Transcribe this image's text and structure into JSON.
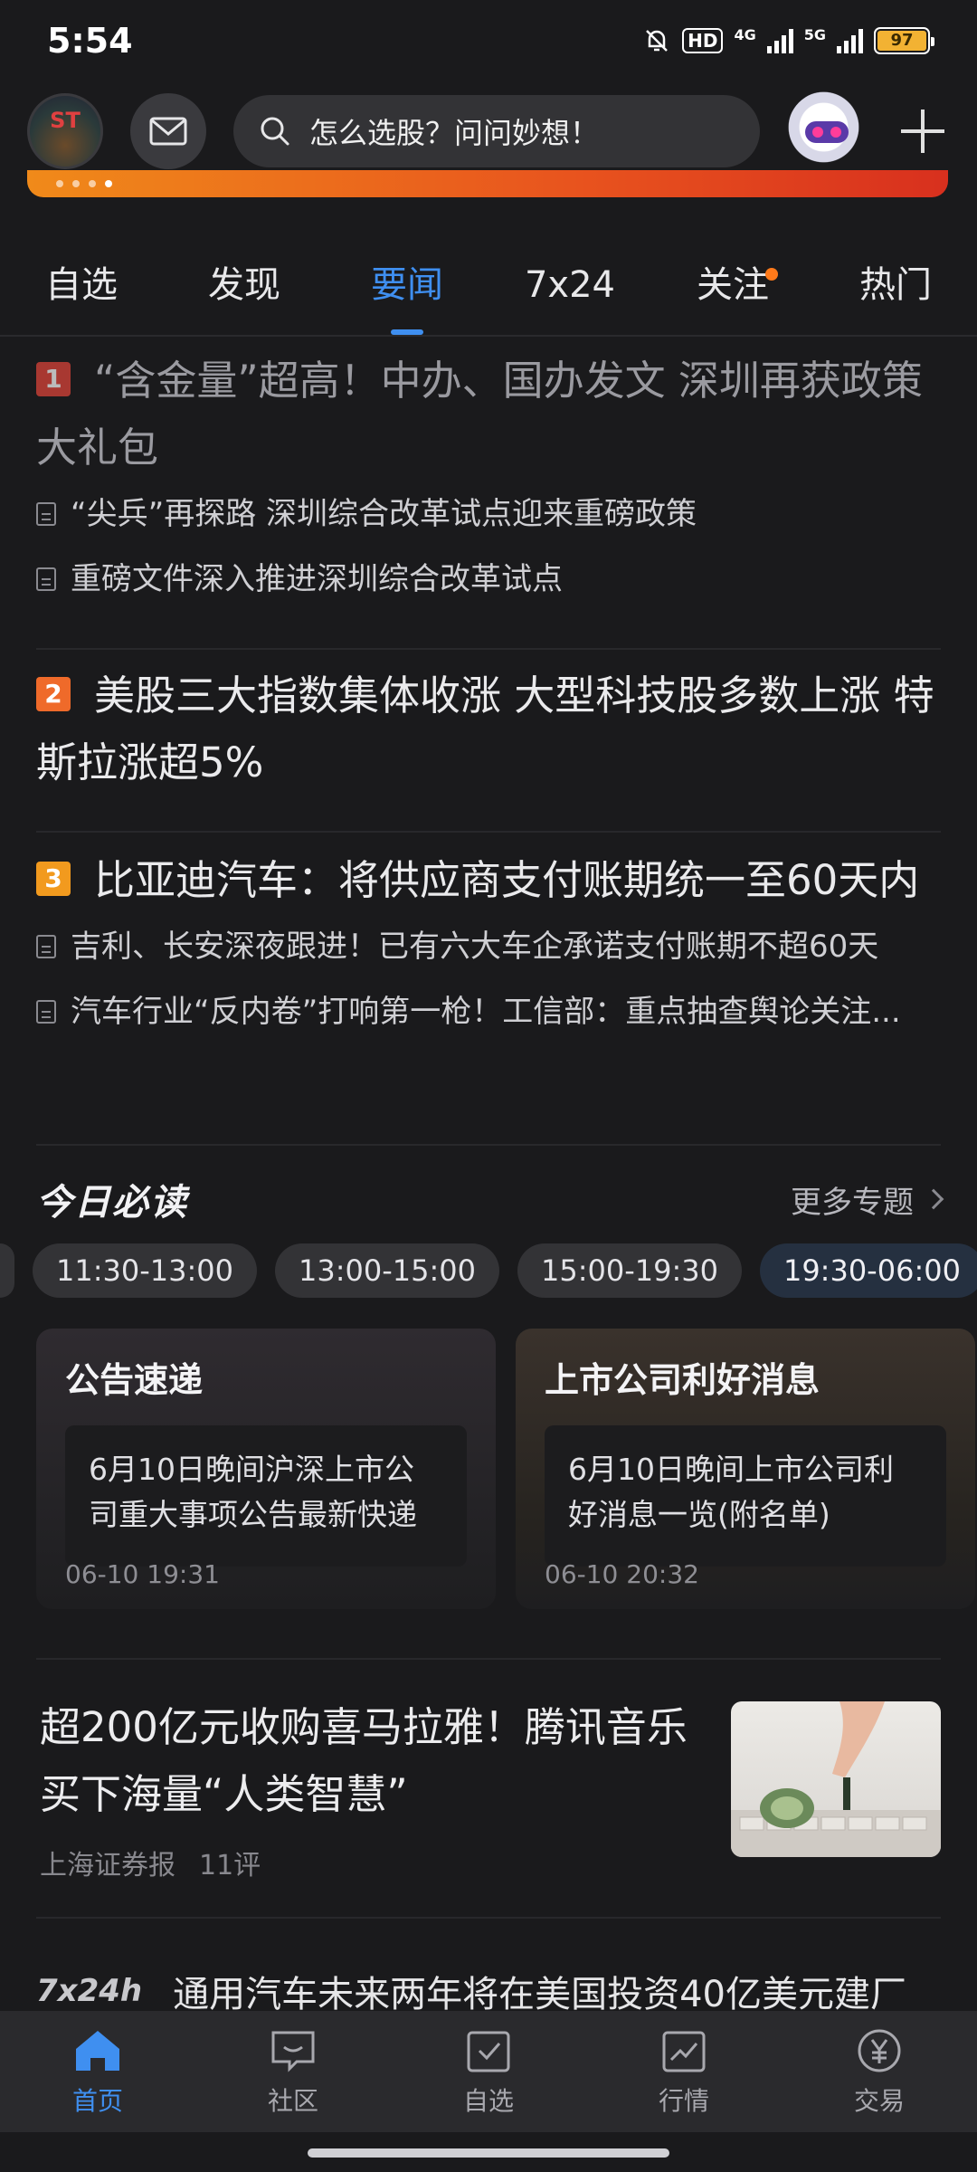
{
  "status_bar": {
    "time": "5:54",
    "hd": "HD",
    "net1": "4G",
    "net2": "5G",
    "battery": "97"
  },
  "header": {
    "avatar_text": "ST",
    "search_placeholder": "怎么选股？问问妙想！"
  },
  "tabs": [
    {
      "label": "自选"
    },
    {
      "label": "发现"
    },
    {
      "label": "要闻",
      "active": true
    },
    {
      "label": "7x24"
    },
    {
      "label": "关注",
      "has_dot": true
    },
    {
      "label": "热门"
    }
  ],
  "news": [
    {
      "rank": "1",
      "title": "“含金量”超高！中办、国办发文 深圳再获政策大礼包",
      "related": [
        "“尖兵”再探路 深圳综合改革试点迎来重磅政策",
        "重磅文件深入推进深圳综合改革试点"
      ]
    },
    {
      "rank": "2",
      "title": "美股三大指数集体收涨 大型科技股多数上涨 特斯拉涨超5%",
      "related": []
    },
    {
      "rank": "3",
      "title": "比亚迪汽车：将供应商支付账期统一至60天内",
      "related": [
        "吉利、长安深夜跟进！已有六大车企承诺支付账期不超60天",
        "汽车行业“反内卷”打响第一枪！工信部：重点抽查舆论关注..."
      ]
    }
  ],
  "must_read": {
    "title": "今日必读",
    "more": "更多专题",
    "time_slots": [
      "11:30-13:00",
      "13:00-15:00",
      "15:00-19:30",
      "19:30-06:00"
    ],
    "active_slot": "19:30-06:00",
    "cards": [
      {
        "title": "公告速递",
        "body": "6月10日晚间沪深上市公司重大事项公告最新快递",
        "time": "06-10 19:31"
      },
      {
        "title": "上市公司利好消息",
        "body": "6月10日晚间上市公司利好消息一览(附名单)",
        "time": "06-10 20:32"
      }
    ]
  },
  "article": {
    "title": "超200亿元收购喜马拉雅！腾讯音乐买下海量“人类智慧”",
    "source": "上海证券报",
    "comments": "11评"
  },
  "flash": {
    "tag": "7x24h",
    "text": "通用汽车未来两年将在美国投资40亿美元建厂"
  },
  "bottom_nav": [
    {
      "label": "首页",
      "icon": "home-icon",
      "active": true
    },
    {
      "label": "社区",
      "icon": "chat-icon"
    },
    {
      "label": "自选",
      "icon": "checkbox-icon"
    },
    {
      "label": "行情",
      "icon": "chart-icon"
    },
    {
      "label": "交易",
      "icon": "yen-icon"
    }
  ],
  "colors": {
    "accent": "#3f8ff0",
    "background": "#1a1a1c",
    "rank1": "#e5463a",
    "rank2": "#ef6a2a",
    "rank3": "#f29a1e"
  }
}
